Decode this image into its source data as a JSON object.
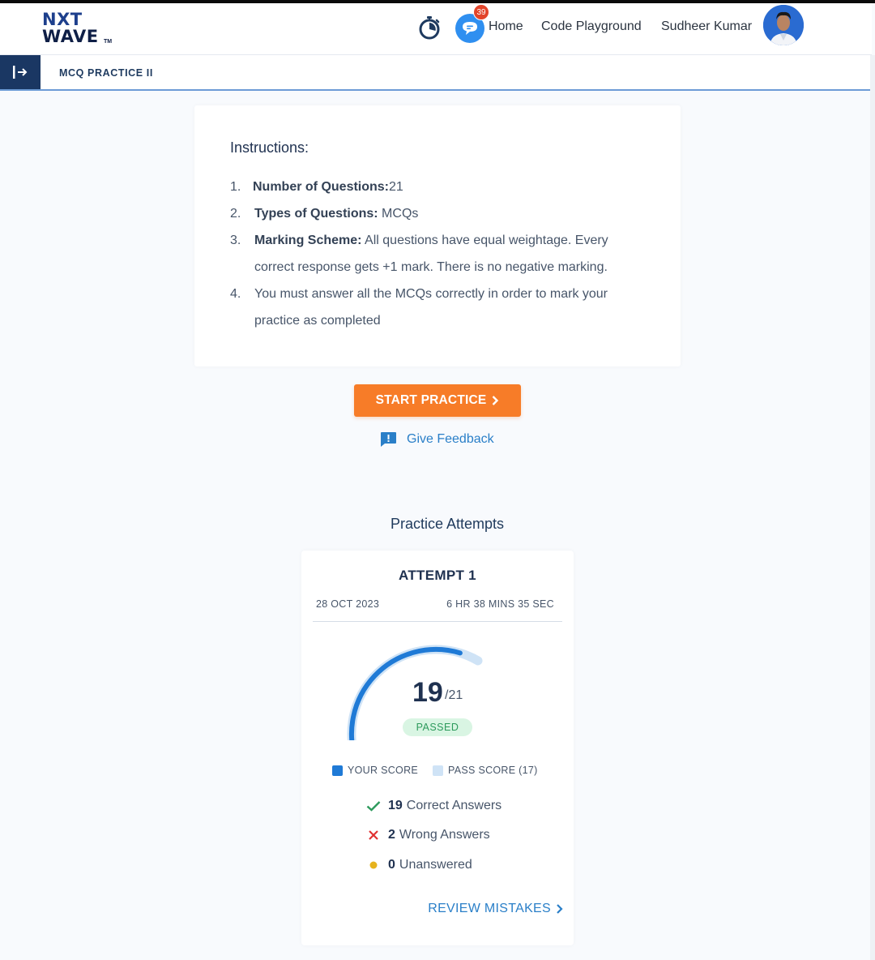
{
  "header": {
    "logo_line1": "NXT",
    "logo_line2": "WAVE",
    "logo_tm": "TM",
    "notification_count": "39",
    "nav": {
      "home": "Home",
      "code_playground": "Code Playground"
    },
    "user_name": "Sudheer Kumar"
  },
  "page": {
    "title": "MCQ PRACTICE II"
  },
  "instructions": {
    "heading": "Instructions:",
    "items": [
      {
        "num": "1.",
        "label": "Number of Questions:",
        "text": "21"
      },
      {
        "num": "2.",
        "label": "Types of Questions:",
        "text": " MCQs"
      },
      {
        "num": "3.",
        "label": "Marking Scheme:",
        "text": "  All questions have equal weightage. Every correct response gets +1 mark. There is no negative marking."
      },
      {
        "num": "4.",
        "label": "",
        "text": "You must answer all the MCQs correctly in order to mark your practice as completed"
      }
    ]
  },
  "actions": {
    "start_practice": "START PRACTICE",
    "give_feedback": "Give Feedback"
  },
  "attempts": {
    "heading": "Practice Attempts",
    "attempt": {
      "title": "ATTEMPT 1",
      "date": "28 OCT 2023",
      "duration": "6 HR 38 MINS 35 SEC",
      "score": "19",
      "max_score": "/21",
      "score_fraction": 0.905,
      "pass_fraction": 0.81,
      "status": "PASSED",
      "legend_your_score": "YOUR SCORE",
      "legend_pass_score": "PASS SCORE (17)",
      "correct_count": "19",
      "correct_label": "Correct Answers",
      "wrong_count": "2",
      "wrong_label": "Wrong Answers",
      "unanswered_count": "0",
      "unanswered_label": "Unanswered",
      "review_label": "REVIEW MISTAKES"
    }
  },
  "colors": {
    "accent_orange": "#f77c28",
    "link_blue": "#2a7fc8",
    "score_blue": "#1f7ad6",
    "pass_light_blue": "#cfe3f6",
    "passed_green": "#2d9a5c",
    "wrong_red": "#e03131",
    "unanswered_yellow": "#e6b31e",
    "nav_dark": "#1a3763"
  },
  "icons": {
    "stopwatch": "stopwatch-icon",
    "chat": "chat-icon",
    "sidebar_toggle": "sidebar-expand-icon",
    "feedback": "feedback-icon",
    "check": "check-icon",
    "cross": "cross-icon",
    "dot": "dot-icon",
    "chevron": "chevron-right-icon"
  }
}
